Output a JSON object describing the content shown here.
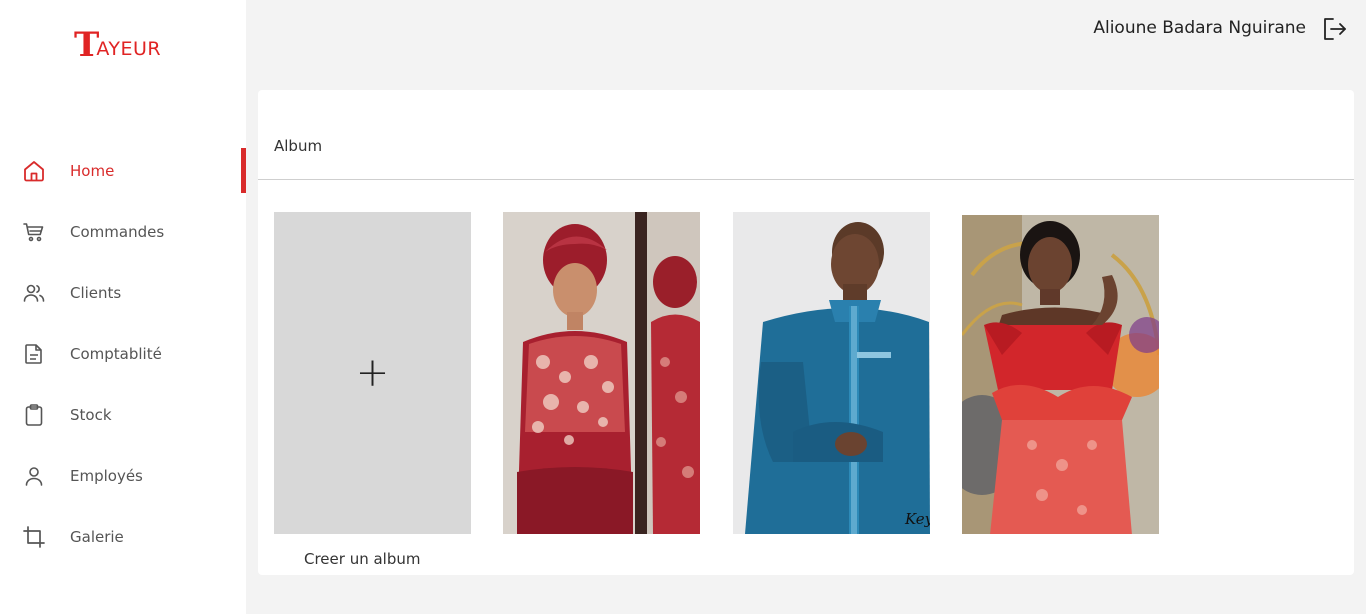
{
  "brand": {
    "logo_initial": "T",
    "logo_rest": "AYEUR",
    "accent": "#d92b2b"
  },
  "header": {
    "user_name": "Alioune Badara Nguirane"
  },
  "sidebar": {
    "items": [
      {
        "label": "Home",
        "icon": "home-icon",
        "active": true
      },
      {
        "label": "Commandes",
        "icon": "cart-icon"
      },
      {
        "label": "Clients",
        "icon": "users-icon"
      },
      {
        "label": "Comptablité",
        "icon": "document-icon"
      },
      {
        "label": "Stock",
        "icon": "clipboard-icon"
      },
      {
        "label": "Employés",
        "icon": "user-icon"
      },
      {
        "label": "Galerie",
        "icon": "crop-icon"
      }
    ]
  },
  "album": {
    "title": "Album",
    "create_label": "Creer un album",
    "create_icon": "+"
  }
}
